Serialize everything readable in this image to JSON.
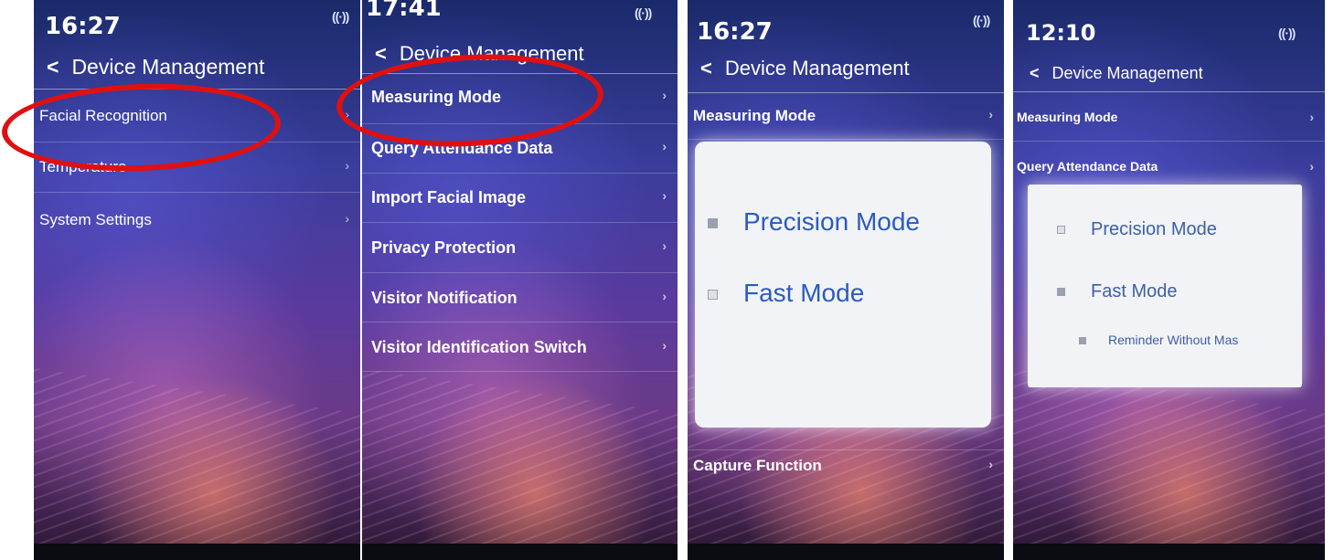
{
  "header_title": "Device Management",
  "chevron": "›",
  "back_icon": "<",
  "accent_color": "#e01010",
  "dialog_text_color": "#2a5bc0",
  "screens": [
    {
      "time": "16:27",
      "items": [
        "Facial Recognition",
        "Temperature",
        "System Settings"
      ]
    },
    {
      "time": "17:41",
      "items": [
        "Measuring Mode",
        "Query Attendance Data",
        "Import Facial Image",
        "Privacy Protection",
        "Visitor Notification",
        "Visitor Identification Switch"
      ]
    },
    {
      "time": "16:27",
      "items": [
        "Measuring Mode",
        "Capture Function"
      ],
      "dialog": {
        "options": [
          {
            "label": "Precision Mode",
            "checked": true
          },
          {
            "label": "Fast Mode",
            "checked": false
          }
        ]
      }
    },
    {
      "time": "12:10",
      "items": [
        "Measuring Mode",
        "Query Attendance Data"
      ],
      "dialog": {
        "options": [
          {
            "label": "Precision Mode",
            "checked": false
          },
          {
            "label": "Fast Mode",
            "checked": true
          }
        ],
        "suboption": {
          "label": "Reminder Without Mas",
          "checked": true
        }
      }
    }
  ]
}
